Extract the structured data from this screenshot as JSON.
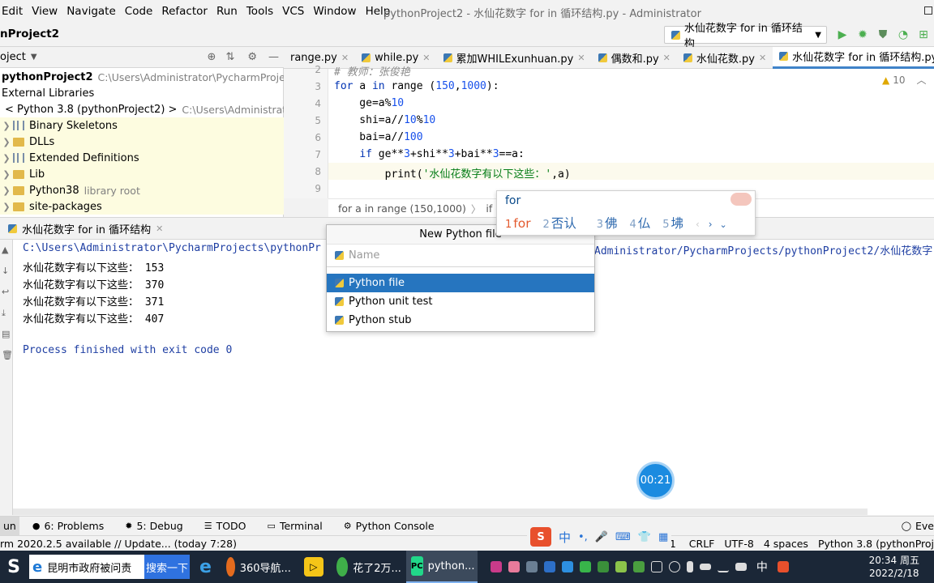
{
  "menu": {
    "items": [
      "Edit",
      "View",
      "Navigate",
      "Code",
      "Refactor",
      "Run",
      "Tools",
      "VCS",
      "Window",
      "Help"
    ],
    "window_title": "pythonProject2 - 水仙花数字 for in 循环结构.py - Administrator"
  },
  "navbar": {
    "project": "nProject2",
    "run_config": "水仙花数字 for in 循环结构"
  },
  "project_pane": {
    "title": "oject",
    "rows": [
      {
        "label": "pythonProject2",
        "path": "C:\\Users\\Administrator\\PycharmProjects\\py"
      },
      {
        "label": "External Libraries",
        "path": ""
      },
      {
        "label": "< Python 3.8 (pythonProject2) >",
        "path": "C:\\Users\\Administrator\\"
      },
      {
        "label": "Binary Skeletons",
        "path": ""
      },
      {
        "label": "DLLs",
        "path": ""
      },
      {
        "label": "Extended Definitions",
        "path": ""
      },
      {
        "label": "Lib",
        "path": ""
      },
      {
        "label": "Python38",
        "path": "library root"
      },
      {
        "label": "site-packages",
        "path": ""
      }
    ]
  },
  "tabs": [
    {
      "label": "range.py",
      "active": false
    },
    {
      "label": "while.py",
      "active": false
    },
    {
      "label": "累加WHILExunhuan.py",
      "active": false
    },
    {
      "label": "偶数和.py",
      "active": false
    },
    {
      "label": "水仙花数.py",
      "active": false
    },
    {
      "label": "水仙花数字 for in 循环结构.py",
      "active": true
    }
  ],
  "editor": {
    "line_numbers": [
      "2",
      "3",
      "4",
      "5",
      "6",
      "7",
      "8",
      "9"
    ],
    "warnings": "10",
    "comment_line": "# 教师：张俊艳",
    "breadcrumb_1": "for a in range (150,1000)",
    "breadcrumb_2": "if ge"
  },
  "run_pane": {
    "tab": "水仙花数字 for in 循环结构",
    "cmd_left": "C:\\Users\\Administrator\\PycharmProjects\\pythonPr",
    "cmd_right": "Administrator/PycharmProjects/pythonProject2/水仙花数字",
    "output": [
      "水仙花数字有以下这些： 153",
      "水仙花数字有以下这些： 370",
      "水仙花数字有以下这些： 371",
      "水仙花数字有以下这些： 407"
    ],
    "exit": "Process finished with exit code 0"
  },
  "new_file_popup": {
    "title": "New Python file",
    "name_placeholder": "Name",
    "items": [
      "Python file",
      "Python unit test",
      "Python stub"
    ]
  },
  "ime": {
    "input": "for",
    "candidates": [
      {
        "n": "1",
        "text": "for"
      },
      {
        "n": "2",
        "text": "否认"
      },
      {
        "n": "3",
        "text": "佛"
      },
      {
        "n": "4",
        "text": "仏"
      },
      {
        "n": "5",
        "text": "坲"
      }
    ]
  },
  "timer": "00:21",
  "toolwindows": {
    "run": "un",
    "problems": "6: Problems",
    "debug": "5: Debug",
    "todo": "TODO",
    "terminal": "Terminal",
    "console": "Python Console",
    "event": "Eve"
  },
  "statusbar": {
    "message": "rm 2020.2.5 available // Update... (today 7:28)",
    "position": "8:31",
    "line_sep": "CRLF",
    "encoding": "UTF-8",
    "indent": "4 spaces",
    "interpreter": "Python 3.8 (pythonProj"
  },
  "taskbar": {
    "search_text": "昆明市政府被问责",
    "search_btn": "搜索一下",
    "apps": [
      "360导航...",
      "花了2万...",
      "python..."
    ],
    "ime_lang": "中",
    "time": "20:34 周五",
    "date": "2022/2/18"
  },
  "colors": {
    "accent": "#2675bf",
    "keyword": "#0033b3",
    "number": "#1750eb",
    "string": "#067d17",
    "run_green": "#4caf50"
  }
}
